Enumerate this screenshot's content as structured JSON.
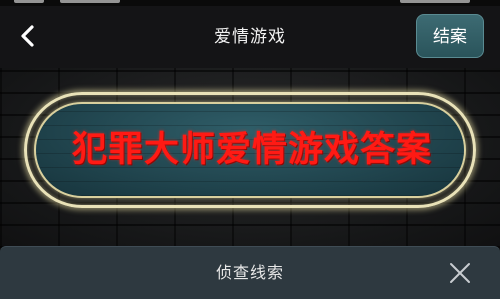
{
  "nav": {
    "title": "爱情游戏",
    "back_icon": "chevron-left-icon",
    "settle_label": "结案"
  },
  "sign": {
    "text": "犯罪大师爱情游戏答案",
    "text_color": "#ff1a14",
    "frame_color": "#e9e2b8",
    "background_color": "#1e4550"
  },
  "clue_panel": {
    "title": "侦查线索",
    "close_icon": "close-icon"
  },
  "colors": {
    "nav_background": "#141416",
    "settle_button": "#3d6b73",
    "panel_background": "#2e3940"
  }
}
